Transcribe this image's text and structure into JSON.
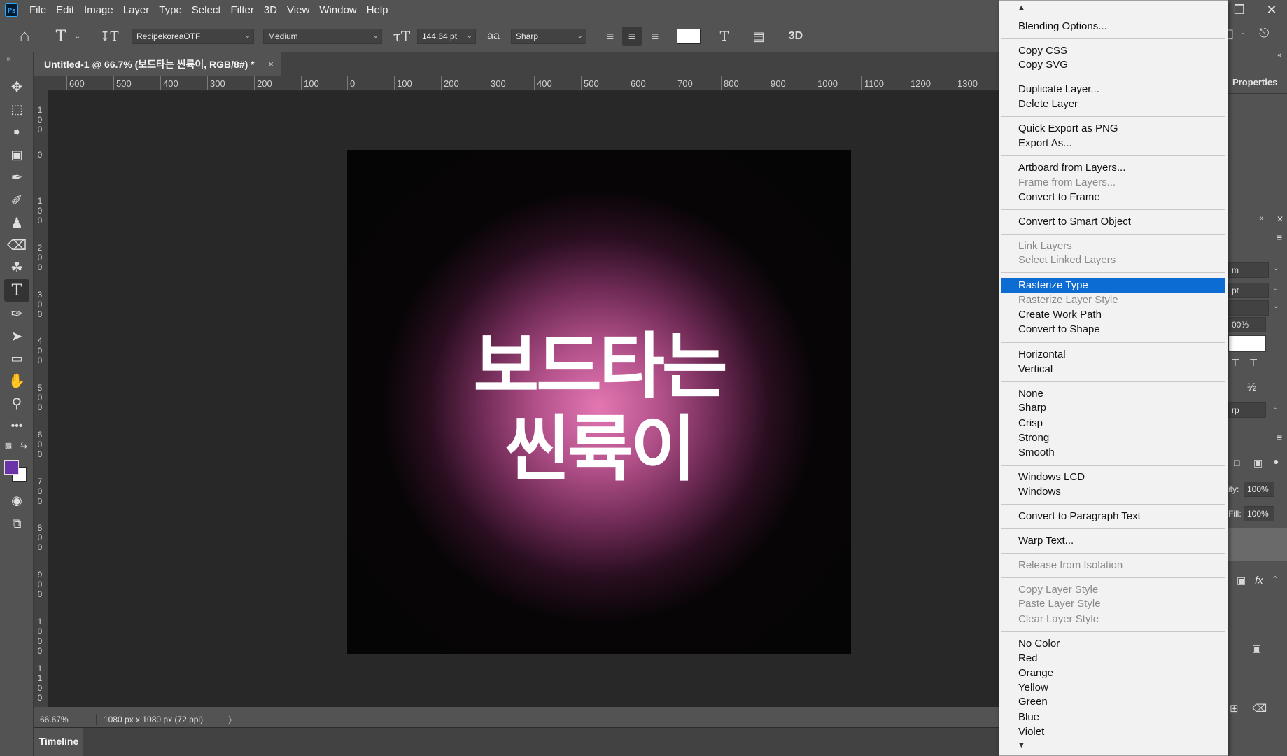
{
  "app": {
    "logo": "Ps",
    "menu": [
      "File",
      "Edit",
      "Image",
      "Layer",
      "Type",
      "Select",
      "Filter",
      "3D",
      "View",
      "Window",
      "Help"
    ]
  },
  "optionsbar": {
    "font_family": "RecipekoreaOTF",
    "font_style": "Medium",
    "font_size": "144.64 pt",
    "antialias": "Sharp",
    "aa_icon": "aа",
    "threed_label": "3D"
  },
  "document": {
    "tab_title": "Untitled-1 @ 66.7% (보드타는 씬륙이, RGB/8#) *",
    "tab_close": "×",
    "canvas_line1": "보드타는",
    "canvas_line2": "씬륙이",
    "ruler_h_labels": [
      "600",
      "500",
      "400",
      "300",
      "200",
      "100",
      "0",
      "100",
      "200",
      "300",
      "400",
      "500",
      "600",
      "700",
      "800",
      "900",
      "1000",
      "1100",
      "1200",
      "1300"
    ],
    "ruler_v_labels": [
      "100",
      "0",
      "100",
      "200",
      "300",
      "400",
      "500",
      "600",
      "700",
      "800",
      "900",
      "1000",
      "1100"
    ]
  },
  "status": {
    "zoom": "66.67%",
    "info": "1080 px x 1080 px (72 ppi)",
    "arrow": "〉"
  },
  "timeline": {
    "tab": "Timeline"
  },
  "rightpanel": {
    "properties_title": "Properties",
    "field_1": "m",
    "field_2": "pt",
    "field_4": "00%",
    "fraction": "½",
    "field_5": "rp",
    "opacity_label": "ity:",
    "opacity_value": "100%",
    "fill_label": "Fill:",
    "fill_value": "100%",
    "fx": "fx"
  },
  "context_menu": {
    "groups": [
      [
        {
          "label": "Blending Options...",
          "enabled": true
        }
      ],
      [
        {
          "label": "Copy CSS",
          "enabled": true
        },
        {
          "label": "Copy SVG",
          "enabled": true
        }
      ],
      [
        {
          "label": "Duplicate Layer...",
          "enabled": true
        },
        {
          "label": "Delete Layer",
          "enabled": true
        }
      ],
      [
        {
          "label": "Quick Export as PNG",
          "enabled": true
        },
        {
          "label": "Export As...",
          "enabled": true
        }
      ],
      [
        {
          "label": "Artboard from Layers...",
          "enabled": true
        },
        {
          "label": "Frame from Layers...",
          "enabled": false
        },
        {
          "label": "Convert to Frame",
          "enabled": true
        }
      ],
      [
        {
          "label": "Convert to Smart Object",
          "enabled": true
        }
      ],
      [
        {
          "label": "Link Layers",
          "enabled": false
        },
        {
          "label": "Select Linked Layers",
          "enabled": false
        }
      ],
      [
        {
          "label": "Rasterize Type",
          "enabled": true,
          "highlight": true
        },
        {
          "label": "Rasterize Layer Style",
          "enabled": false
        },
        {
          "label": "Create Work Path",
          "enabled": true
        },
        {
          "label": "Convert to Shape",
          "enabled": true
        }
      ],
      [
        {
          "label": "Horizontal",
          "enabled": true
        },
        {
          "label": "Vertical",
          "enabled": true
        }
      ],
      [
        {
          "label": "None",
          "enabled": true
        },
        {
          "label": "Sharp",
          "enabled": true
        },
        {
          "label": "Crisp",
          "enabled": true
        },
        {
          "label": "Strong",
          "enabled": true
        },
        {
          "label": "Smooth",
          "enabled": true
        }
      ],
      [
        {
          "label": "Windows LCD",
          "enabled": true
        },
        {
          "label": "Windows",
          "enabled": true
        }
      ],
      [
        {
          "label": "Convert to Paragraph Text",
          "enabled": true
        }
      ],
      [
        {
          "label": "Warp Text...",
          "enabled": true
        }
      ],
      [
        {
          "label": "Release from Isolation",
          "enabled": false
        }
      ],
      [
        {
          "label": "Copy Layer Style",
          "enabled": false
        },
        {
          "label": "Paste Layer Style",
          "enabled": false
        },
        {
          "label": "Clear Layer Style",
          "enabled": false
        }
      ],
      [
        {
          "label": "No Color",
          "enabled": true
        },
        {
          "label": "Red",
          "enabled": true
        },
        {
          "label": "Orange",
          "enabled": true
        },
        {
          "label": "Yellow",
          "enabled": true
        },
        {
          "label": "Green",
          "enabled": true
        },
        {
          "label": "Blue",
          "enabled": true
        },
        {
          "label": "Violet",
          "enabled": true
        }
      ]
    ]
  },
  "colors": {
    "foreground": "#6a34a8",
    "background": "#ffffff",
    "text_color_swatch": "#ffffff",
    "menu_highlight": "#0d6bd4"
  },
  "icons": {
    "tools": [
      "move-icon",
      "marquee-icon",
      "lasso-icon",
      "object-select-icon",
      "eyedropper-icon",
      "brush-icon",
      "stamp-icon",
      "eraser-icon",
      "paint-bucket-icon",
      "type-icon",
      "pen-icon",
      "path-select-icon",
      "rectangle-icon",
      "hand-icon",
      "zoom-icon",
      "more-icon"
    ]
  }
}
